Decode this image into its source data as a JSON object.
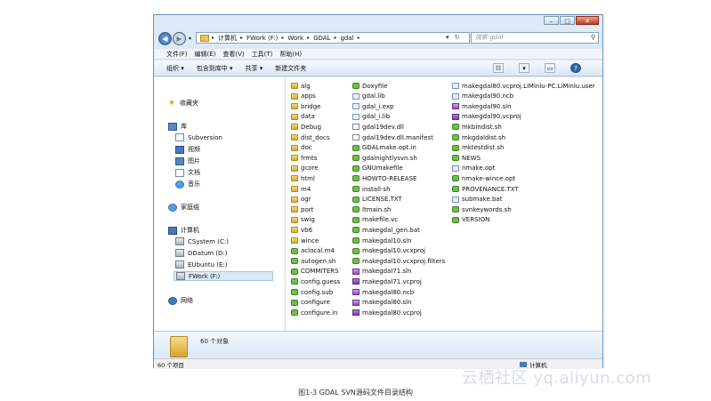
{
  "window": {
    "buttons": {
      "minimize": "–",
      "maximize": "□",
      "close": "✕"
    }
  },
  "address": {
    "crumbs": [
      "计算机",
      "FWork (F:)",
      "Work",
      "GDAL",
      "gdal"
    ],
    "search_placeholder": "搜索 gdal"
  },
  "menu": [
    "文件(F)",
    "编辑(E)",
    "查看(V)",
    "工具(T)",
    "帮助(H)"
  ],
  "toolbar": [
    "组织 ▾",
    "包含到库中 ▾",
    "共享 ▾",
    "新建文件夹"
  ],
  "nav": {
    "favorites": "收藏夹",
    "libraries": "库",
    "lib_items": [
      "Subversion",
      "视频",
      "图片",
      "文档",
      "音乐"
    ],
    "homegroup": "家庭组",
    "computer": "计算机",
    "drives": [
      "CSystem (C:)",
      "DDatum (D:)",
      "EUbuntu (E:)",
      "FWork (F:)"
    ],
    "network": "网络"
  },
  "files": [
    [
      {
        "name": "alg",
        "icon": "folder"
      },
      {
        "name": "apps",
        "icon": "folder"
      },
      {
        "name": "bridge",
        "icon": "folder"
      },
      {
        "name": "data",
        "icon": "folder"
      },
      {
        "name": "Debug",
        "icon": "folder"
      },
      {
        "name": "dist_docs",
        "icon": "folder"
      },
      {
        "name": "doc",
        "icon": "folder"
      },
      {
        "name": "frmts",
        "icon": "folder"
      },
      {
        "name": "gcore",
        "icon": "folder"
      },
      {
        "name": "html",
        "icon": "folder"
      },
      {
        "name": "m4",
        "icon": "folder"
      },
      {
        "name": "ogr",
        "icon": "folder"
      },
      {
        "name": "port",
        "icon": "folder"
      },
      {
        "name": "swig",
        "icon": "folder"
      },
      {
        "name": "vb6",
        "icon": "folder"
      },
      {
        "name": "wince",
        "icon": "folder"
      },
      {
        "name": "aclocal.m4",
        "icon": "green"
      },
      {
        "name": "autogen.sh",
        "icon": "green"
      },
      {
        "name": "COMMITERS",
        "icon": "green"
      },
      {
        "name": "config.guess",
        "icon": "green"
      },
      {
        "name": "config.sub",
        "icon": "green"
      },
      {
        "name": "configure",
        "icon": "green"
      },
      {
        "name": "configure.in",
        "icon": "green"
      }
    ],
    [
      {
        "name": "Doxyfile",
        "icon": "green"
      },
      {
        "name": "gdal.lib",
        "icon": "lib"
      },
      {
        "name": "gdal_i.exp",
        "icon": "lib"
      },
      {
        "name": "gdal_i.lib",
        "icon": "lib"
      },
      {
        "name": "gdal19dev.dll",
        "icon": "file"
      },
      {
        "name": "gdal19dev.dll.manifest",
        "icon": "file"
      },
      {
        "name": "GDALmake.opt.in",
        "icon": "green"
      },
      {
        "name": "gdalnightlysvn.sh",
        "icon": "green"
      },
      {
        "name": "GNUmakefile",
        "icon": "green"
      },
      {
        "name": "HOWTO-RELEASE",
        "icon": "green"
      },
      {
        "name": "install-sh",
        "icon": "green"
      },
      {
        "name": "LICENSE.TXT",
        "icon": "green"
      },
      {
        "name": "ltmain.sh",
        "icon": "green"
      },
      {
        "name": "makefile.vc",
        "icon": "green"
      },
      {
        "name": "makegdal_gen.bat",
        "icon": "green"
      },
      {
        "name": "makegdal10.sln",
        "icon": "green"
      },
      {
        "name": "makegdal10.vcxproj",
        "icon": "green"
      },
      {
        "name": "makegdal10.vcxproj.filters",
        "icon": "green"
      },
      {
        "name": "makegdal71.sln",
        "icon": "sln"
      },
      {
        "name": "makegdal71.vcproj",
        "icon": "vcproj"
      },
      {
        "name": "makegdal80.ncb",
        "icon": "sln"
      },
      {
        "name": "makegdal80.sln",
        "icon": "sln"
      },
      {
        "name": "makegdal80.vcproj",
        "icon": "vcproj"
      }
    ],
    [
      {
        "name": "makegdal80.vcproj.LiMinlu-PC.LiMinlu.user",
        "icon": "lib"
      },
      {
        "name": "makegdal90.ncb",
        "icon": "lib"
      },
      {
        "name": "makegdal90.sln",
        "icon": "sln"
      },
      {
        "name": "makegdal90.vcproj",
        "icon": "vcproj"
      },
      {
        "name": "mkbindist.sh",
        "icon": "green"
      },
      {
        "name": "mkgdaldist.sh",
        "icon": "green"
      },
      {
        "name": "mktestdist.sh",
        "icon": "green"
      },
      {
        "name": "NEWS",
        "icon": "green"
      },
      {
        "name": "nmake.opt",
        "icon": "lib"
      },
      {
        "name": "nmake-wince.opt",
        "icon": "green"
      },
      {
        "name": "PROVENANCE.TXT",
        "icon": "green"
      },
      {
        "name": "submake.bat",
        "icon": "lib"
      },
      {
        "name": "svnkeywords.sh",
        "icon": "green"
      },
      {
        "name": "VERSION",
        "icon": "green"
      }
    ]
  ],
  "details": {
    "count": "60 个对象"
  },
  "status": {
    "left": "60 个项目",
    "right": "计算机"
  },
  "caption": "图1-3 GDAL SVN源码文件目录结构",
  "watermark": "云栖社区 yq.aliyun.com"
}
